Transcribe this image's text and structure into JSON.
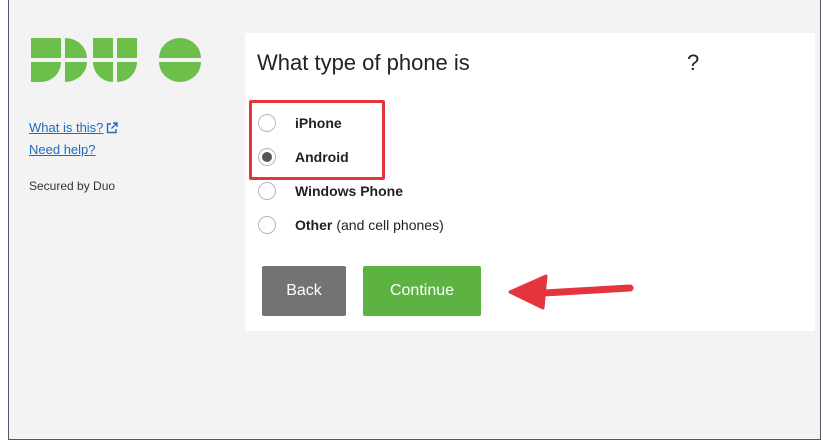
{
  "sidebar": {
    "logo_text": "DUO",
    "logo_color": "#6dbf4b",
    "links": [
      {
        "label": "What is this?",
        "icon": "external-link-icon"
      },
      {
        "label": "Need help?"
      }
    ],
    "secured_text": "Secured by Duo"
  },
  "prompt": {
    "title": "What type of phone is",
    "title_suffix": "?",
    "options": [
      {
        "label": "iPhone",
        "sub": "",
        "selected": false
      },
      {
        "label": "Android",
        "sub": "",
        "selected": true
      },
      {
        "label": "Windows Phone",
        "sub": "",
        "selected": false
      },
      {
        "label": "Other",
        "sub": "(and cell phones)",
        "selected": false
      }
    ],
    "buttons": {
      "back_label": "Back",
      "continue_label": "Continue"
    }
  },
  "colors": {
    "accent_green": "#5cb342",
    "back_gray": "#737373",
    "annotation_red": "#e3353b",
    "link_blue": "#1c6dbf"
  }
}
